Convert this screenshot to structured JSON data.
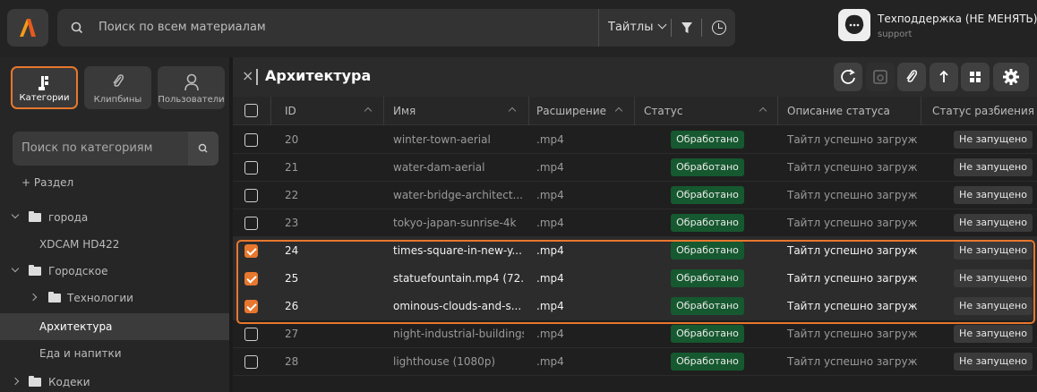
{
  "search": {
    "placeholder": "Поиск по всем материалам",
    "scope": "Тайтлы"
  },
  "support": {
    "name": "Техподдержка (НЕ МЕНЯТЬ)",
    "login": "support"
  },
  "sidebar": {
    "tabs": [
      {
        "label": "Категории",
        "icon": "categories-icon",
        "active": true
      },
      {
        "label": "Клипбины",
        "icon": "paperclip-icon",
        "active": false
      },
      {
        "label": "Пользователи",
        "icon": "user-icon",
        "active": false
      }
    ],
    "search_placeholder": "Поиск по категориям",
    "add_section": "+ Раздел",
    "tree": [
      {
        "label": "города",
        "level": 0,
        "expanded": true,
        "folder": true
      },
      {
        "label": "XDCAM HD422",
        "level": 1,
        "folder": false
      },
      {
        "label": "Городское",
        "level": 0,
        "expanded": true,
        "folder": true
      },
      {
        "label": "Технологии",
        "level": 1,
        "expanded": false,
        "folder": true
      },
      {
        "label": "Архитектура",
        "level": 1,
        "folder": false,
        "selected": true
      },
      {
        "label": "Еда и напитки",
        "level": 1,
        "folder": false
      },
      {
        "label": "Кодеки",
        "level": 0,
        "expanded": false,
        "folder": true
      }
    ]
  },
  "main": {
    "title": "Архитектура",
    "toolbar_icons": [
      "refresh-icon",
      "camera-icon",
      "paperclip-icon",
      "upload-arrow-icon",
      "grid-icon",
      "settings-icon"
    ]
  },
  "table": {
    "columns": [
      "ID",
      "Имя",
      "Расширение",
      "Статус",
      "Описание статуса",
      "Статус разбиения на"
    ],
    "rows": [
      {
        "checked": false,
        "id": "20",
        "name": "winter-town-aerial",
        "ext": ".mp4",
        "status": "Обработано",
        "desc": "Тайтл успешно загруж...",
        "split": "Не запущено"
      },
      {
        "checked": false,
        "id": "21",
        "name": "water-dam-aerial",
        "ext": ".mp4",
        "status": "Обработано",
        "desc": "Тайтл успешно загруж...",
        "split": "Не запущено"
      },
      {
        "checked": false,
        "id": "22",
        "name": "water-bridge-architect...",
        "ext": ".mp4",
        "status": "Обработано",
        "desc": "Тайтл успешно загруж...",
        "split": "Не запущено"
      },
      {
        "checked": false,
        "id": "23",
        "name": "tokyo-japan-sunrise-4k",
        "ext": ".mp4",
        "status": "Обработано",
        "desc": "Тайтл успешно загруж...",
        "split": "Не запущено"
      },
      {
        "checked": true,
        "id": "24",
        "name": "times-square-in-new-y...",
        "ext": ".mp4",
        "status": "Обработано",
        "desc": "Тайтл успешно загруж...",
        "split": "Не запущено"
      },
      {
        "checked": true,
        "id": "25",
        "name": "statuefountain.mp4 (72...",
        "ext": ".mp4",
        "status": "Обработано",
        "desc": "Тайтл успешно загруж...",
        "split": "Не запущено"
      },
      {
        "checked": true,
        "id": "26",
        "name": "ominous-clouds-and-s...",
        "ext": ".mp4",
        "status": "Обработано",
        "desc": "Тайтл успешно загруж...",
        "split": "Не запущено"
      },
      {
        "checked": false,
        "id": "27",
        "name": "night-industrial-buildings",
        "ext": ".mp4",
        "status": "Обработано",
        "desc": "Тайтл успешно загруж...",
        "split": "Не запущено"
      },
      {
        "checked": false,
        "id": "28",
        "name": "lighthouse (1080p)",
        "ext": ".mp4",
        "status": "Обработано",
        "desc": "Тайтл успешно загруж...",
        "split": "Не запущено"
      }
    ]
  },
  "colors": {
    "accent": "#e8772e",
    "status_ok": "#16582f"
  }
}
